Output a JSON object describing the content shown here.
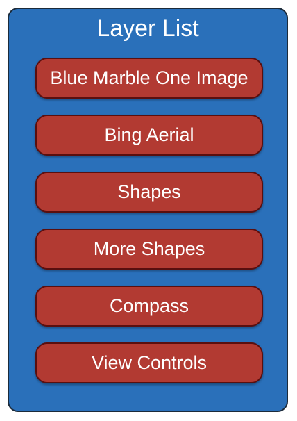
{
  "panel": {
    "title": "Layer List",
    "colors": {
      "panel_fill": "#2a70ba",
      "panel_border": "#1c2b3a",
      "button_fill": "#b23a32",
      "button_border": "#5a0f0f",
      "text": "#ffffff"
    }
  },
  "layers": [
    {
      "label": "Blue Marble One Image"
    },
    {
      "label": "Bing Aerial"
    },
    {
      "label": "Shapes"
    },
    {
      "label": "More Shapes"
    },
    {
      "label": "Compass"
    },
    {
      "label": "View Controls"
    }
  ]
}
